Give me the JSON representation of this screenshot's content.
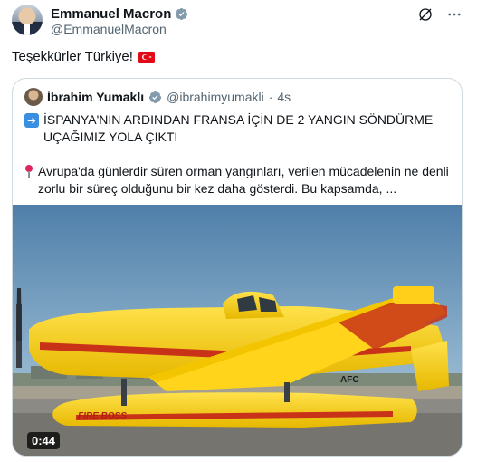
{
  "author": {
    "name": "Emmanuel Macron",
    "handle": "@EmmanuelMacron"
  },
  "post": {
    "text": "Teşekkürler Türkiye!",
    "flag_icon": "turkey-flag-icon"
  },
  "quote": {
    "author_name": "İbrahim Yumaklı",
    "author_handle": "@ibrahimyumakli",
    "separator": "·",
    "time": "4s",
    "line1": "İSPANYA'NIN ARDINDAN FRANSA İÇİN DE 2 YANGIN SÖNDÜRME UÇAĞIMIZ YOLA ÇIKTI",
    "line2": "Avrupa'da günlerdir süren orman yangınları, verilen mücadelenin ne denli zorlu bir süreç olduğunu bir kez daha gösterdi. Bu kapsamda, ...",
    "media": {
      "duration": "0:44",
      "aircraft_lettering": "FIRE BOSS",
      "tail_marking": "AFC"
    }
  },
  "colors": {
    "verified_blue": "#1d9bf0",
    "text_primary": "#0f1419",
    "text_secondary": "#536471",
    "border": "#cfd9de"
  }
}
